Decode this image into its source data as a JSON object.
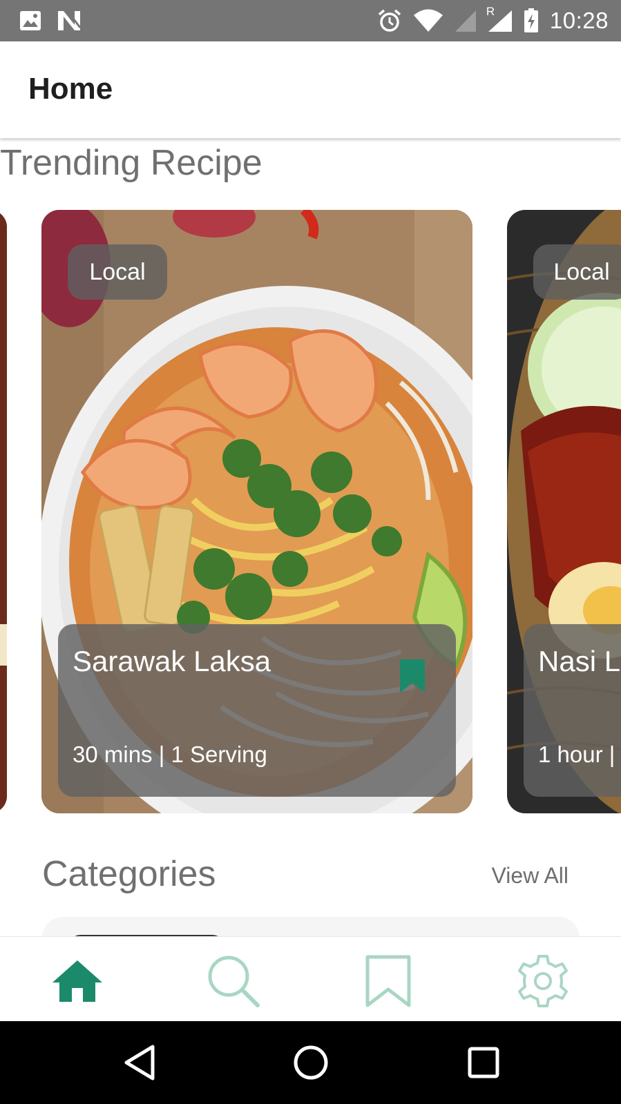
{
  "status_bar": {
    "time": "10:28",
    "network_label": "R",
    "icons": [
      "image-icon",
      "n-notification-icon",
      "alarm-icon",
      "wifi-icon",
      "signal-icon",
      "signal-roaming-icon",
      "battery-charging-icon"
    ]
  },
  "app_bar": {
    "title": "Home"
  },
  "trending": {
    "title": "Trending Recipe",
    "cards": [
      {
        "tag": "Local",
        "name": "Sarawak Laksa",
        "meta": "30 mins | 1 Serving",
        "bookmarked": true
      },
      {
        "tag": "Local",
        "name": "Nasi L",
        "meta": "1 hour |"
      }
    ]
  },
  "categories": {
    "title": "Categories",
    "view_all": "View All"
  },
  "bottom_nav": {
    "items": [
      {
        "icon": "home-icon",
        "active": true
      },
      {
        "icon": "search-icon",
        "active": false
      },
      {
        "icon": "bookmark-icon",
        "active": false
      },
      {
        "icon": "settings-icon",
        "active": false
      }
    ],
    "active_color": "#1a8a6a",
    "inactive_color": "#a9d6c3"
  },
  "system_nav": {
    "icons": [
      "back-icon",
      "home-circle-icon",
      "recents-icon"
    ]
  }
}
